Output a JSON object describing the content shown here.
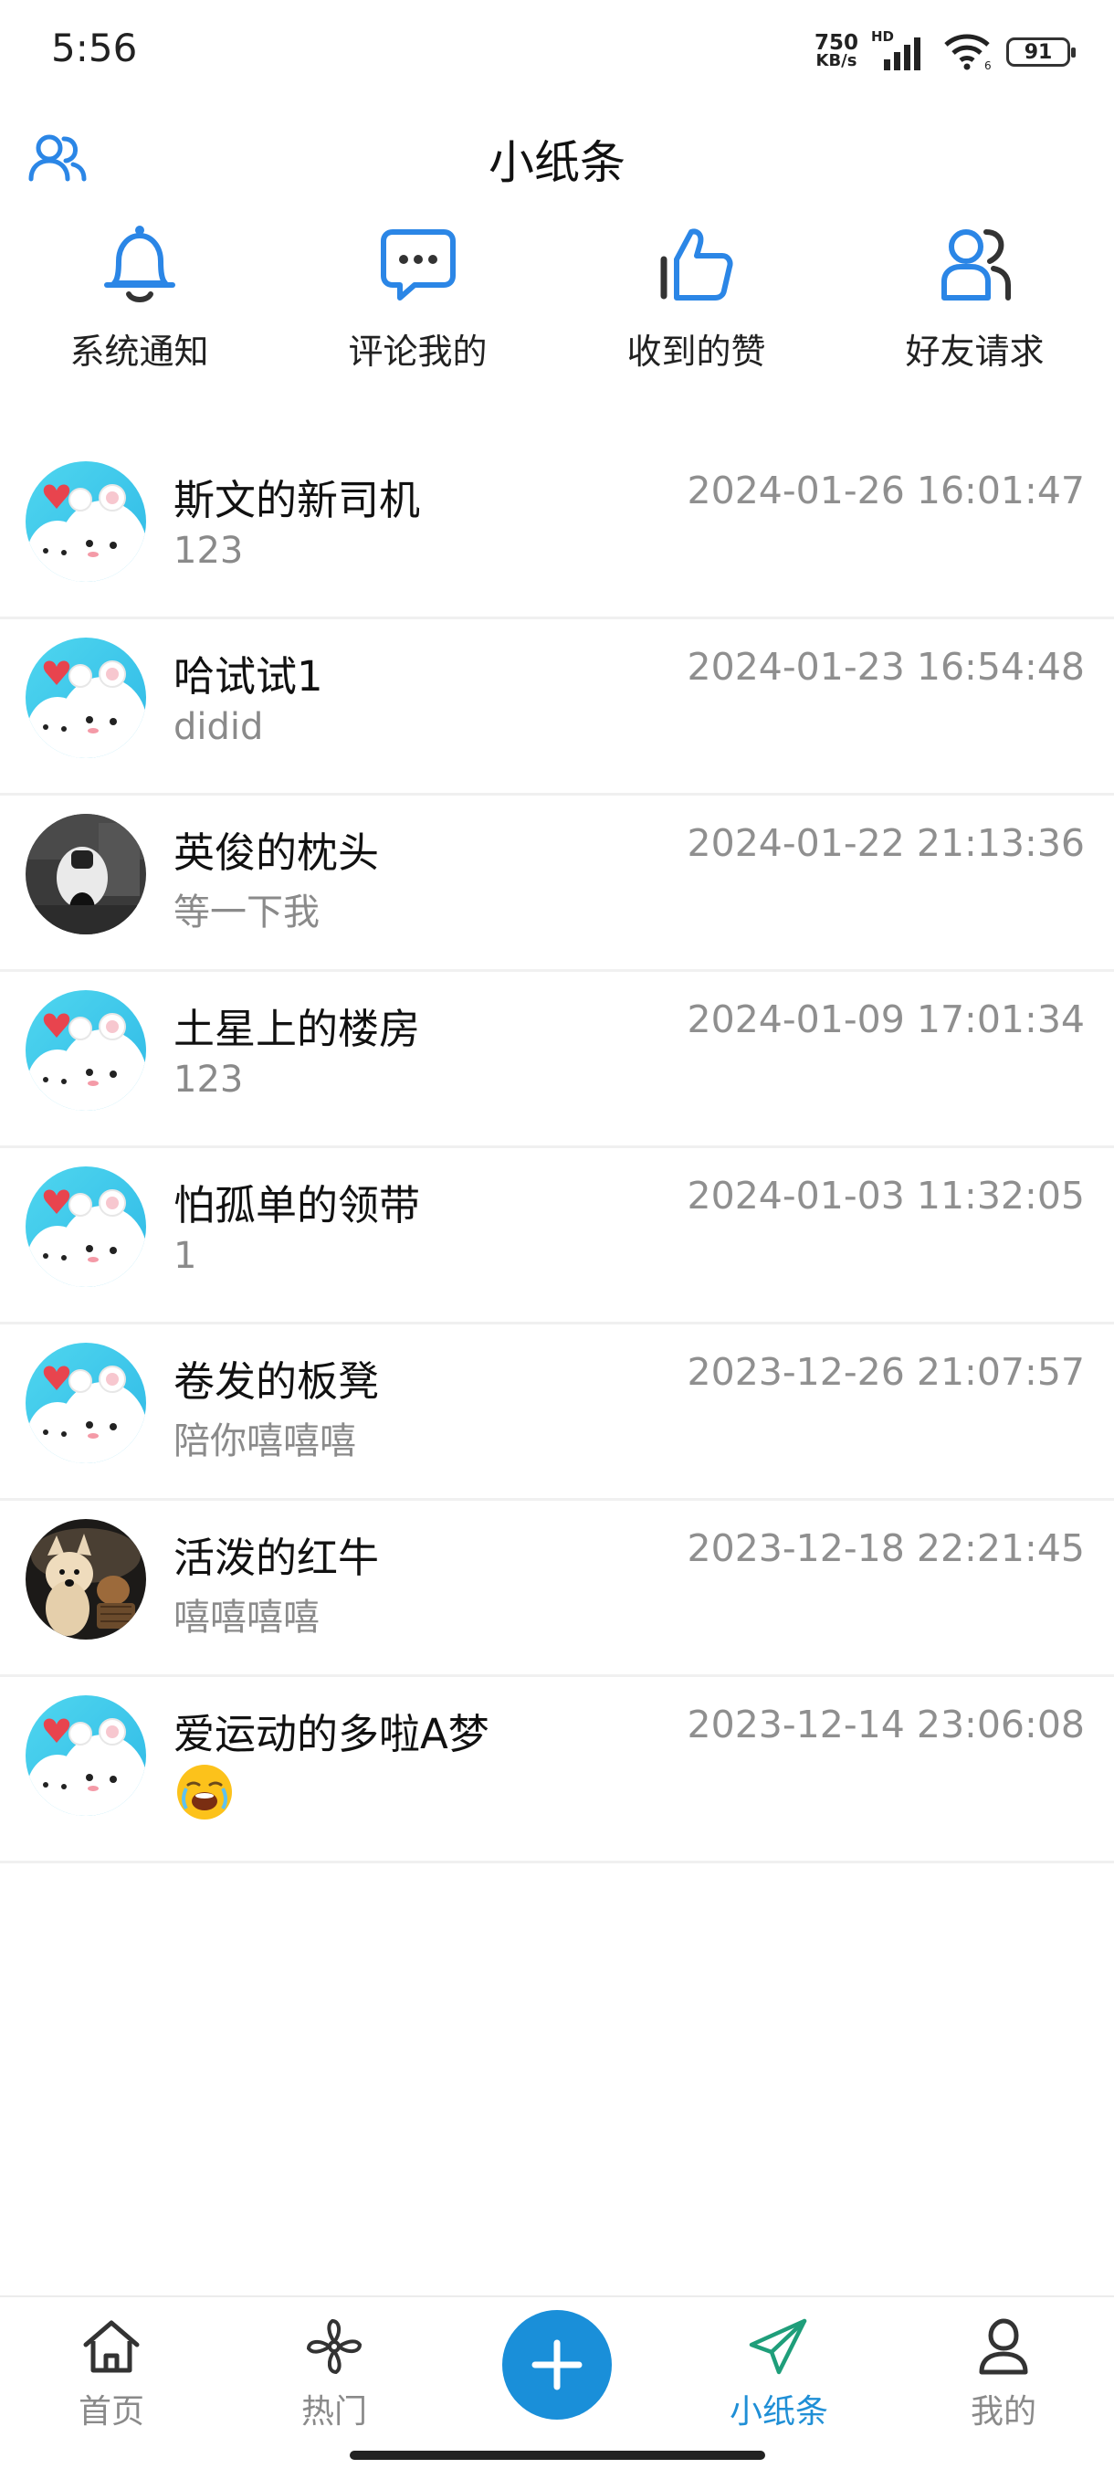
{
  "status_bar": {
    "time": "5:56",
    "net_speed_value": "750",
    "net_speed_unit": "KB/s",
    "signal_badge": "HD",
    "battery_level": "91"
  },
  "header": {
    "title": "小纸条"
  },
  "quick_actions": [
    {
      "label": "系统通知",
      "icon": "bell-icon"
    },
    {
      "label": "评论我的",
      "icon": "comment-icon"
    },
    {
      "label": "收到的赞",
      "icon": "thumbs-up-icon"
    },
    {
      "label": "好友请求",
      "icon": "friend-request-icon"
    }
  ],
  "messages": [
    {
      "name": "斯文的新司机",
      "preview": "123",
      "time": "2024-01-26 16:01:47",
      "avatar": "cartoon-mice"
    },
    {
      "name": "哈试试1",
      "preview": "didid",
      "time": "2024-01-23 16:54:48",
      "avatar": "cartoon-mice"
    },
    {
      "name": "英俊的枕头",
      "preview": "等一下我",
      "time": "2024-01-22 21:13:36",
      "avatar": "scooter-photo"
    },
    {
      "name": "土星上的楼房",
      "preview": "123",
      "time": "2024-01-09 17:01:34",
      "avatar": "cartoon-mice"
    },
    {
      "name": "怕孤单的领带",
      "preview": "1",
      "time": "2024-01-03 11:32:05",
      "avatar": "cartoon-mice"
    },
    {
      "name": "卷发的板凳",
      "preview": "陪你嘻嘻嘻",
      "time": "2023-12-26 21:07:57",
      "avatar": "cartoon-mice"
    },
    {
      "name": "活泼的红牛",
      "preview": "嘻嘻嘻嘻",
      "time": "2023-12-18 22:21:45",
      "avatar": "dog-cat-photo"
    },
    {
      "name": "爱运动的多啦A梦",
      "preview": "",
      "preview_emoji": "crying-face-emoji",
      "time": "2023-12-14 23:06:08",
      "avatar": "cartoon-mice"
    }
  ],
  "bottom_nav": {
    "items": [
      {
        "label": "首页",
        "icon": "home-icon"
      },
      {
        "label": "热门",
        "icon": "pinwheel-icon"
      },
      {
        "label": "",
        "icon": "plus-icon"
      },
      {
        "label": "小纸条",
        "icon": "paper-plane-icon",
        "active": true
      },
      {
        "label": "我的",
        "icon": "user-icon"
      }
    ]
  },
  "colors": {
    "accent": "#1f8fd6",
    "icon_blue": "#2b86e6",
    "text_primary": "#111111",
    "text_secondary": "#8a8a8a"
  }
}
